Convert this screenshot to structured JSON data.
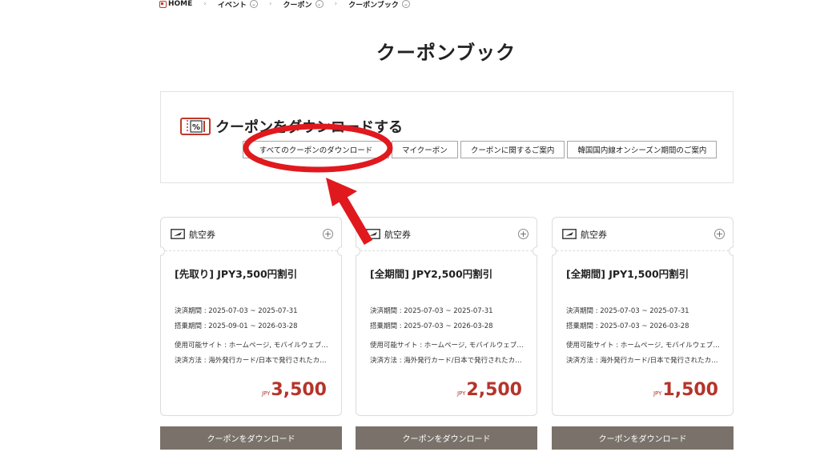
{
  "breadcrumb": {
    "items": [
      "HOME",
      "イベント",
      "クーポン",
      "クーポンブック"
    ]
  },
  "page_title": "クーポンブック",
  "download_section": {
    "heading": "クーポンをダウンロードする",
    "buttons": [
      "すべてのクーポンのダウンロード",
      "マイクーポン",
      "クーポンに関するご案内",
      "韓国国内線オンシーズン期間のご案内"
    ]
  },
  "cards": [
    {
      "category": "航空券",
      "title": "[先取り] JPY3,500円割引",
      "payment_period": "決済期間 : 2025-07-03 ~ 2025-07-31",
      "boarding_period": "搭乗期間 : 2025-09-01 ~ 2026-03-28",
      "sites": "使用可能サイト : ホームページ, モバイルウェブ…",
      "payment_method": "決済方法 : 海外発行カード/日本で発行されたカ…",
      "currency": "JPY",
      "amount": "3,500",
      "download_label": "クーポンをダウンロード"
    },
    {
      "category": "航空券",
      "title": "[全期間] JPY2,500円割引",
      "payment_period": "決済期間 : 2025-07-03 ~ 2025-07-31",
      "boarding_period": "搭乗期間 : 2025-07-03 ~ 2026-03-28",
      "sites": "使用可能サイト : ホームページ, モバイルウェブ…",
      "payment_method": "決済方法 : 海外発行カード/日本で発行されたカ…",
      "currency": "JPY",
      "amount": "2,500",
      "download_label": "クーポンをダウンロード"
    },
    {
      "category": "航空券",
      "title": "[全期間] JPY1,500円割引",
      "payment_period": "決済期間 : 2025-07-03 ~ 2025-07-31",
      "boarding_period": "搭乗期間 : 2025-07-03 ~ 2026-03-28",
      "sites": "使用可能サイト : ホームページ, モバイルウェブ…",
      "payment_method": "決済方法 : 海外発行カード/日本で発行されたカ…",
      "currency": "JPY",
      "amount": "1,500",
      "download_label": "クーポンをダウンロード"
    }
  ],
  "colors": {
    "price": "#b5342a",
    "download_button_bg": "#7a726a",
    "annotation": "#e0191e"
  }
}
